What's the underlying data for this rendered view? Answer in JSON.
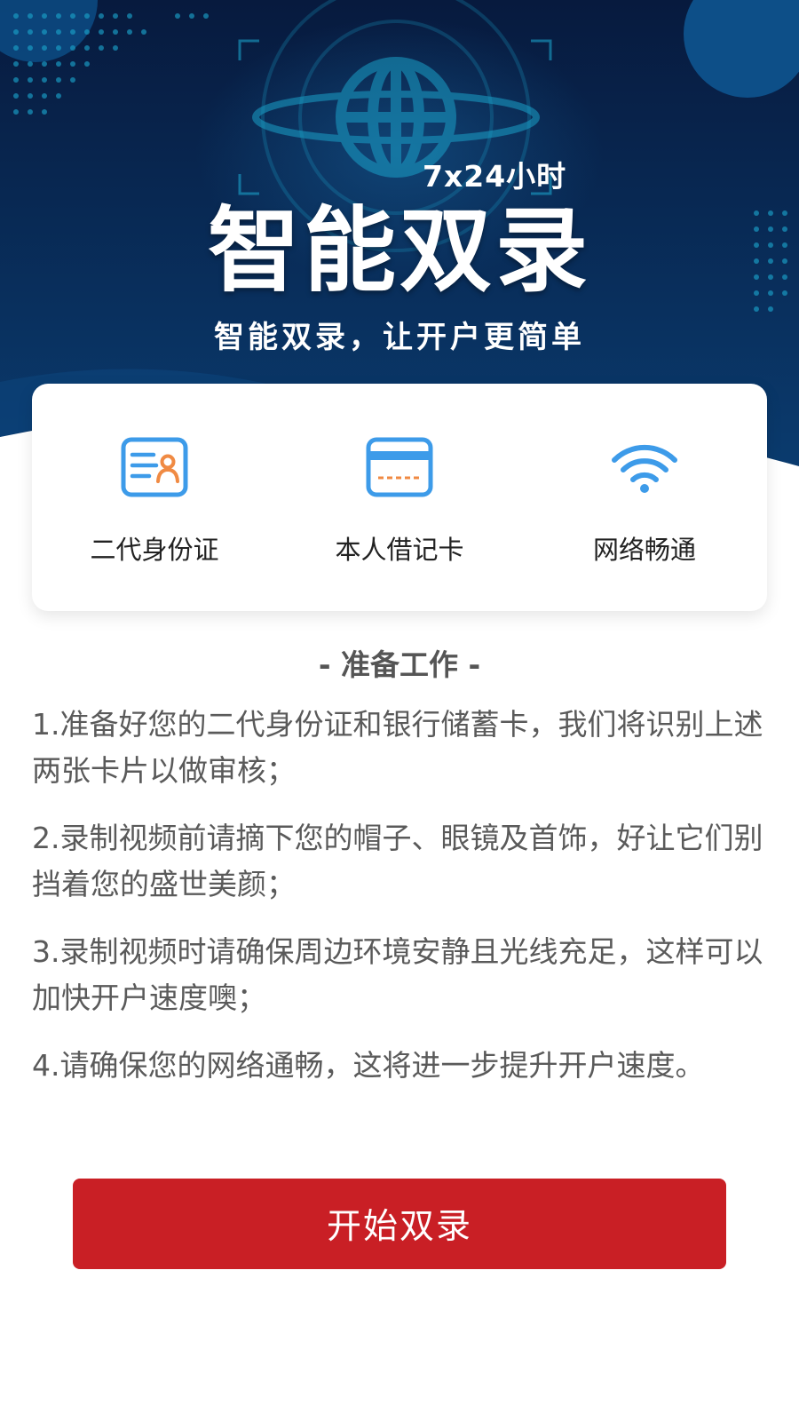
{
  "banner": {
    "tagline": "7x24小时",
    "title": "智能双录",
    "subtitle": "智能双录，让开户更简单",
    "colors": {
      "bg_top": "#071a3e",
      "bg_bottom": "#0a3b6e",
      "accent": "#1aa0c8"
    }
  },
  "requirements": [
    {
      "icon": "id-card-icon",
      "label": "二代身份证"
    },
    {
      "icon": "bank-card-icon",
      "label": "本人借记卡"
    },
    {
      "icon": "wifi-icon",
      "label": "网络畅通"
    }
  ],
  "preparation": {
    "title": "- 准备工作 -",
    "items": [
      "1.准备好您的二代身份证和银行储蓄卡，我们将识别上述两张卡片以做审核；",
      "2.录制视频前请摘下您的帽子、眼镜及首饰，好让它们别挡着您的盛世美颜；",
      "3.录制视频时请确保周边环境安静且光线充足，这样可以加快开户速度噢；",
      "4.请确保您的网络通畅，这将进一步提升开户速度。"
    ]
  },
  "action": {
    "start_label": "开始双录",
    "color": "#c91f25"
  },
  "icon_colors": {
    "blue": "#3d9be9",
    "orange": "#f08a43"
  }
}
